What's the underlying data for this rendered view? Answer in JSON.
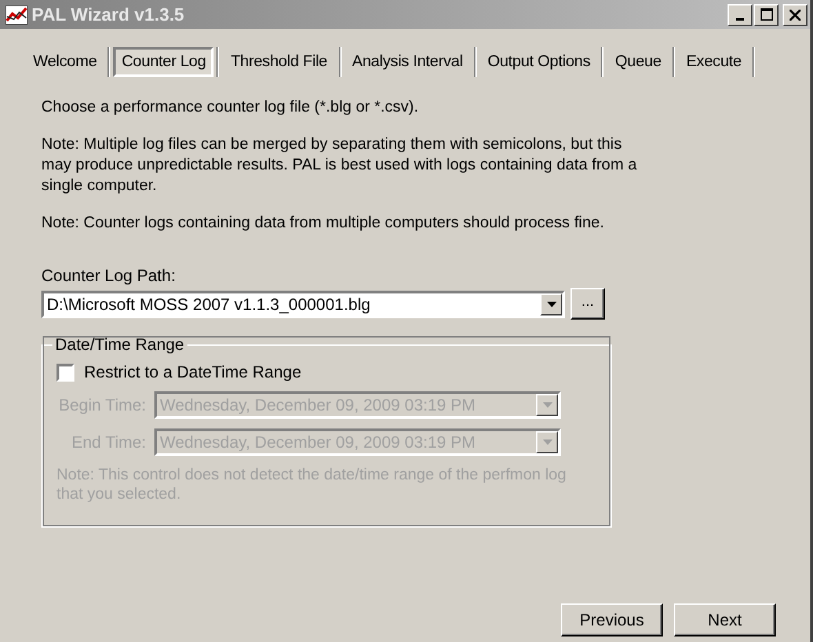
{
  "window": {
    "title": "PAL Wizard v1.3.5"
  },
  "tabs": [
    {
      "label": "Welcome",
      "selected": false
    },
    {
      "label": "Counter Log",
      "selected": true
    },
    {
      "label": "Threshold File",
      "selected": false
    },
    {
      "label": "Analysis Interval",
      "selected": false
    },
    {
      "label": "Output Options",
      "selected": false
    },
    {
      "label": "Queue",
      "selected": false
    },
    {
      "label": "Execute",
      "selected": false
    }
  ],
  "paragraphs": [
    "Choose a performance counter log file (*.blg or *.csv).",
    "Note: Multiple log files can be merged by separating them with semicolons, but this may produce unpredictable results. PAL is best used with logs containing data from a single computer.",
    "Note: Counter logs containing data from multiple computers should process fine."
  ],
  "counter_log_path": {
    "label": "Counter Log Path:",
    "value": "D:\\Microsoft MOSS 2007 v1.1.3_000001.blg",
    "browse": "..."
  },
  "date_time_range": {
    "title": "Date/Time Range",
    "restrict": {
      "label": "Restrict to a DateTime Range",
      "checked": false
    },
    "fields": [
      {
        "label": "Begin Time:",
        "value": "Wednesday, December 09, 2009 03:19 PM",
        "disabled": true
      },
      {
        "label": "End Time:",
        "value": "Wednesday, December 09, 2009 03:19 PM",
        "disabled": true
      }
    ],
    "note": {
      "text": "Note: This control does not detect the date/time range of the perfmon log that you selected.",
      "disabled": true
    }
  },
  "buttons": [
    {
      "label": "Previous"
    },
    {
      "label": "Next"
    }
  ]
}
